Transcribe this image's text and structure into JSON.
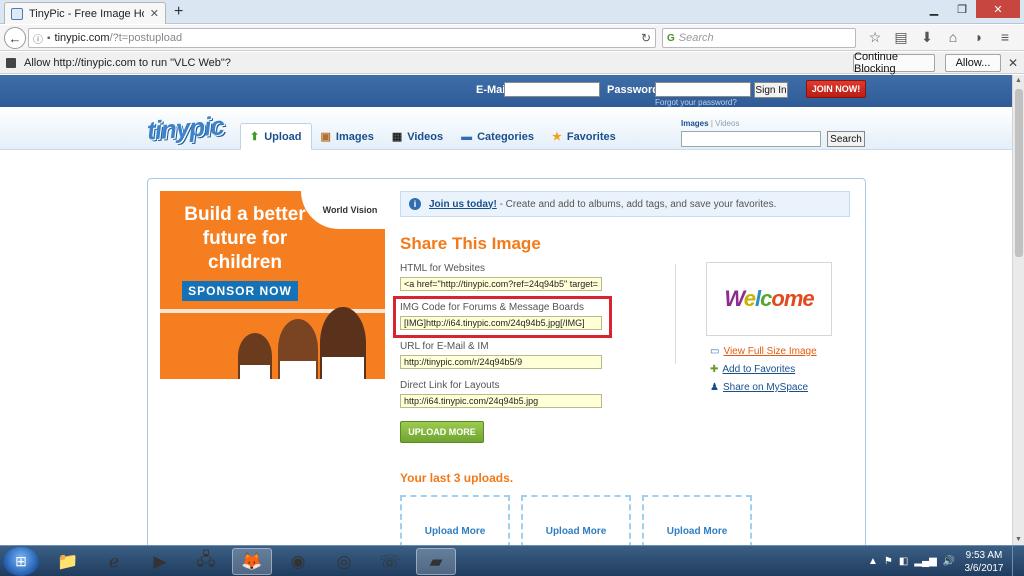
{
  "browser": {
    "tab_title": "TinyPic - Free Image Hosti...",
    "url_host": "tinypic.com",
    "url_path": "/?t=postupload",
    "search_placeholder": "Search",
    "notification": "Allow http://tinypic.com to run \"VLC Web\"?",
    "continue_blocking": "Continue Blocking",
    "allow": "Allow..."
  },
  "login": {
    "email_label": "E-Mail:",
    "password_label": "Password:",
    "sign_in": "Sign In",
    "forgot": "Forgot your password?",
    "join": "JOIN NOW!"
  },
  "header": {
    "logo": "tinypic",
    "tabs": [
      {
        "label": "Upload",
        "icon": "upload-arrow-icon"
      },
      {
        "label": "Images",
        "icon": "images-icon"
      },
      {
        "label": "Videos",
        "icon": "film-icon"
      },
      {
        "label": "Categories",
        "icon": "categories-icon"
      },
      {
        "label": "Favorites",
        "icon": "star-icon"
      }
    ],
    "search_images": "Images",
    "search_sep": "|",
    "search_videos": "Videos",
    "search_button": "Search"
  },
  "ad": {
    "brand": "World Vision",
    "headline": "Build a better future for children",
    "cta": "SPONSOR NOW"
  },
  "info": {
    "link": "Join us today!",
    "text": " - Create and add to albums, add tags, and save your favorites."
  },
  "share": {
    "title": "Share This Image",
    "fields": [
      {
        "label": "HTML for Websites",
        "value": "<a href=\"http://tinypic.com?ref=24q94b5\" target="
      },
      {
        "label": "IMG Code for Forums & Message Boards",
        "value": "[IMG]http://i64.tinypic.com/24q94b5.jpg[/IMG]"
      },
      {
        "label": "URL for E-Mail & IM",
        "value": "http://tinypic.com/r/24q94b5/9"
      },
      {
        "label": "Direct Link for Layouts",
        "value": "http://i64.tinypic.com/24q94b5.jpg"
      }
    ],
    "upload_more": "UPLOAD MORE"
  },
  "thumbnail": {
    "word": [
      "W",
      "e",
      "l",
      "c",
      "ome"
    ]
  },
  "side_links": [
    {
      "label": "View Full Size Image",
      "icon": "monitor-icon"
    },
    {
      "label": "Add to Favorites",
      "icon": "favorites-icon"
    },
    {
      "label": "Share on MySpace",
      "icon": "myspace-icon"
    }
  ],
  "last_uploads": {
    "title": "Your last 3 uploads.",
    "slots": [
      "Upload More",
      "Upload More",
      "Upload More"
    ]
  },
  "taskbar": {
    "time": "9:53 AM",
    "date": "3/6/2017"
  }
}
